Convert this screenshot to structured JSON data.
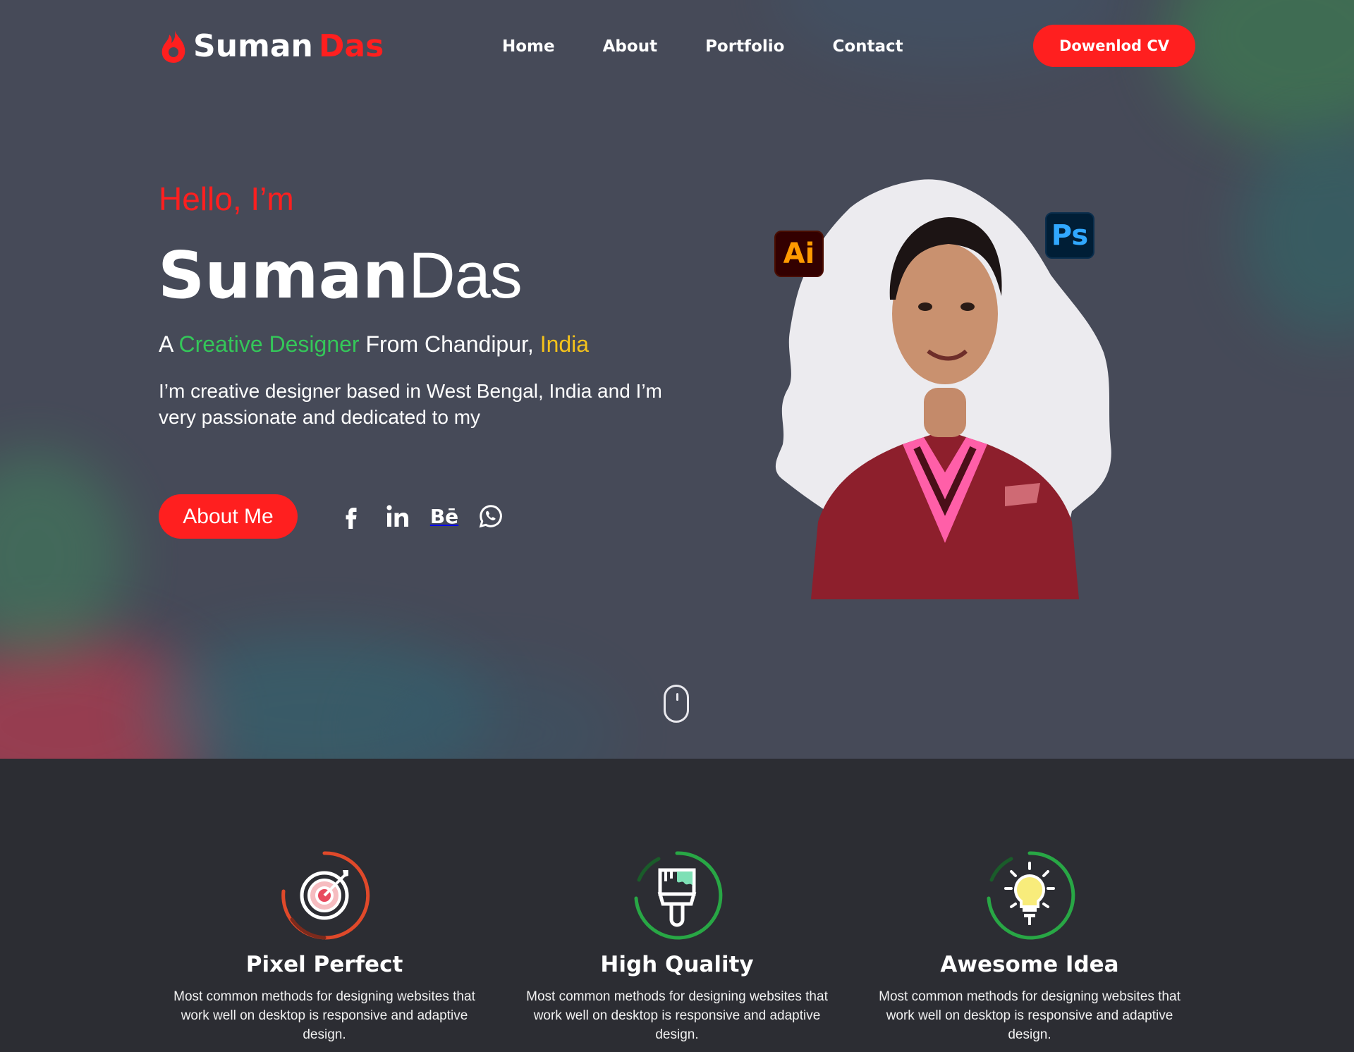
{
  "brand": {
    "first": "Suman",
    "last": "Das",
    "accent": "#ff1f1f"
  },
  "nav": {
    "items": [
      {
        "label": "Home"
      },
      {
        "label": "About"
      },
      {
        "label": "Portfolio"
      },
      {
        "label": "Contact"
      }
    ],
    "cta_label": "Dowenlod CV"
  },
  "hero": {
    "greeting": "Hello, I’m",
    "name_first": "Suman",
    "name_last": "Das",
    "tagline": {
      "prefix": "A ",
      "role": "Creative Designer",
      "middle": " From Chandipur, ",
      "country": "India"
    },
    "description": "I’m creative designer based in West Bengal, India and I’m very passionate and dedicated to my",
    "about_button": "About Me",
    "social_icons": [
      "facebook-icon",
      "linkedin-icon",
      "behance-icon",
      "whatsapp-icon"
    ],
    "behance_text": "Bē",
    "badges": {
      "ai": "Ai",
      "ps": "Ps"
    },
    "colors": {
      "role": "#34c759",
      "country": "#f4c21b",
      "background": "#464a58"
    }
  },
  "features": [
    {
      "icon": "target-icon",
      "title": "Pixel Perfect",
      "text": "Most common methods for designing websites that work well on desktop is responsive and adaptive design."
    },
    {
      "icon": "paint-brush-icon",
      "title": "High Quality",
      "text": "Most common methods for designing websites that work well on desktop is responsive and adaptive design."
    },
    {
      "icon": "light-bulb-icon",
      "title": "Awesome Idea",
      "text": "Most common methods for designing websites that work well on desktop is responsive and adaptive design."
    }
  ]
}
